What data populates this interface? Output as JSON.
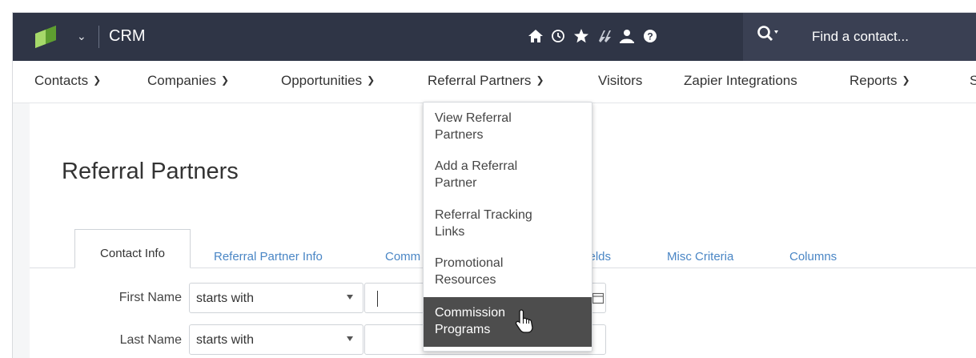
{
  "app": {
    "name": "CRM"
  },
  "header": {
    "icons": [
      "home-icon",
      "history-icon",
      "star-icon",
      "zapier-icon",
      "person-icon",
      "help-icon"
    ],
    "search_placeholder": "Find a contact..."
  },
  "nav": {
    "items": [
      {
        "label": "Contacts",
        "has_menu": true
      },
      {
        "label": "Companies",
        "has_menu": true
      },
      {
        "label": "Opportunities",
        "has_menu": true
      },
      {
        "label": "Referral Partners",
        "has_menu": true
      },
      {
        "label": "Visitors",
        "has_menu": false
      },
      {
        "label": "Zapier Integrations",
        "has_menu": false
      },
      {
        "label": "Reports",
        "has_menu": true
      },
      {
        "label": "S",
        "has_menu": false
      }
    ]
  },
  "page": {
    "title": "Referral Partners"
  },
  "tabs": [
    {
      "label": "Contact Info",
      "active": true
    },
    {
      "label": "Referral Partner Info"
    },
    {
      "label": "Comm"
    },
    {
      "label": "Fields"
    },
    {
      "label": "Misc Criteria"
    },
    {
      "label": "Columns"
    }
  ],
  "filters": [
    {
      "label": "First Name",
      "operator": "starts with"
    },
    {
      "label": "Last Name",
      "operator": "starts with"
    }
  ],
  "dropdown": {
    "items": [
      {
        "line1": "View Referral",
        "line2": "Partners"
      },
      {
        "line1": "Add a Referral",
        "line2": "Partner"
      },
      {
        "line1": "Referral Tracking",
        "line2": "Links"
      },
      {
        "line1": "Promotional",
        "line2": "Resources"
      },
      {
        "line1": "Commission",
        "line2": "Programs",
        "hovered": true
      }
    ]
  },
  "colors": {
    "topbar": "#2f3546",
    "accent_link": "#4a86c5",
    "logo_green": "#7cc142",
    "hover_bg": "#4d4d4d"
  }
}
